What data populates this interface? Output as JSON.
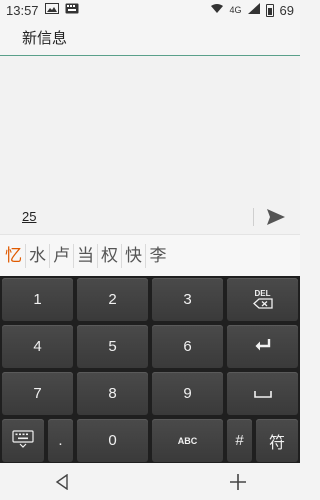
{
  "status_bar": {
    "time": "13:57",
    "icons": [
      "image-icon",
      "keyboard-icon"
    ],
    "network": "4G",
    "battery": "69"
  },
  "header": {
    "title": "新信息"
  },
  "compose": {
    "text": "25",
    "send_icon": "send-icon"
  },
  "candidates": [
    "忆",
    "水",
    "卢",
    "当",
    "权",
    "快",
    "李"
  ],
  "keyboard": {
    "rows": [
      [
        "1",
        "2",
        "3",
        "DEL"
      ],
      [
        "4",
        "5",
        "6",
        "enter"
      ],
      [
        "7",
        "8",
        "9",
        "space"
      ],
      [
        "kbd",
        ".",
        "0",
        "ABC",
        "#",
        "符"
      ]
    ],
    "del_label": "DEL",
    "abc_label": "ABC",
    "symbol_label": "符",
    "hash_label": "#",
    "dot_label": ".",
    "zero_label": "0"
  },
  "navbar": {
    "back_icon": "back-icon",
    "add_icon": "plus-icon"
  }
}
